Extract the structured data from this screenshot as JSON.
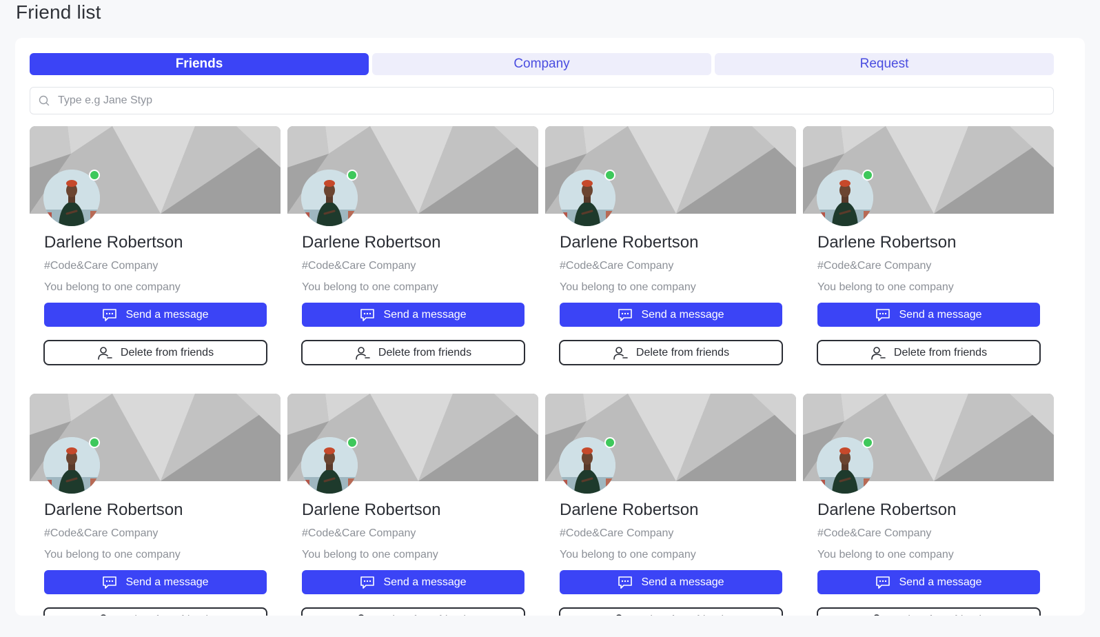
{
  "page": {
    "title": "Friend list"
  },
  "tabs": [
    {
      "label": "Friends",
      "active": true
    },
    {
      "label": "Company",
      "active": false
    },
    {
      "label": "Request",
      "active": false
    }
  ],
  "search": {
    "placeholder": "Type e.g Jane Styp",
    "value": ""
  },
  "icons": {
    "search": "search-icon",
    "message": "chat-bubble-icon",
    "delete": "user-remove-icon",
    "status": "online-status-icon"
  },
  "colors": {
    "accent": "#3b44f6",
    "tab_inactive_bg": "#eeeefb",
    "online": "#3ec85b"
  },
  "friends": [
    {
      "name": "Darlene Robertson",
      "company": "#Code&Care Company",
      "note": "You belong to one company",
      "message_label": "Send a message",
      "delete_label": "Delete from friends",
      "online": true
    },
    {
      "name": "Darlene Robertson",
      "company": "#Code&Care Company",
      "note": "You belong to one company",
      "message_label": "Send a message",
      "delete_label": "Delete from friends",
      "online": true
    },
    {
      "name": "Darlene Robertson",
      "company": "#Code&Care Company",
      "note": "You belong to one company",
      "message_label": "Send a message",
      "delete_label": "Delete from friends",
      "online": true
    },
    {
      "name": "Darlene Robertson",
      "company": "#Code&Care Company",
      "note": "You belong to one company",
      "message_label": "Send a message",
      "delete_label": "Delete from friends",
      "online": true
    },
    {
      "name": "Darlene Robertson",
      "company": "#Code&Care Company",
      "note": "You belong to one company",
      "message_label": "Send a message",
      "delete_label": "Delete from friends",
      "online": true
    },
    {
      "name": "Darlene Robertson",
      "company": "#Code&Care Company",
      "note": "You belong to one company",
      "message_label": "Send a message",
      "delete_label": "Delete from friends",
      "online": true
    },
    {
      "name": "Darlene Robertson",
      "company": "#Code&Care Company",
      "note": "You belong to one company",
      "message_label": "Send a message",
      "delete_label": "Delete from friends",
      "online": true
    },
    {
      "name": "Darlene Robertson",
      "company": "#Code&Care Company",
      "note": "You belong to one company",
      "message_label": "Send a message",
      "delete_label": "Delete from friends",
      "online": true
    }
  ]
}
